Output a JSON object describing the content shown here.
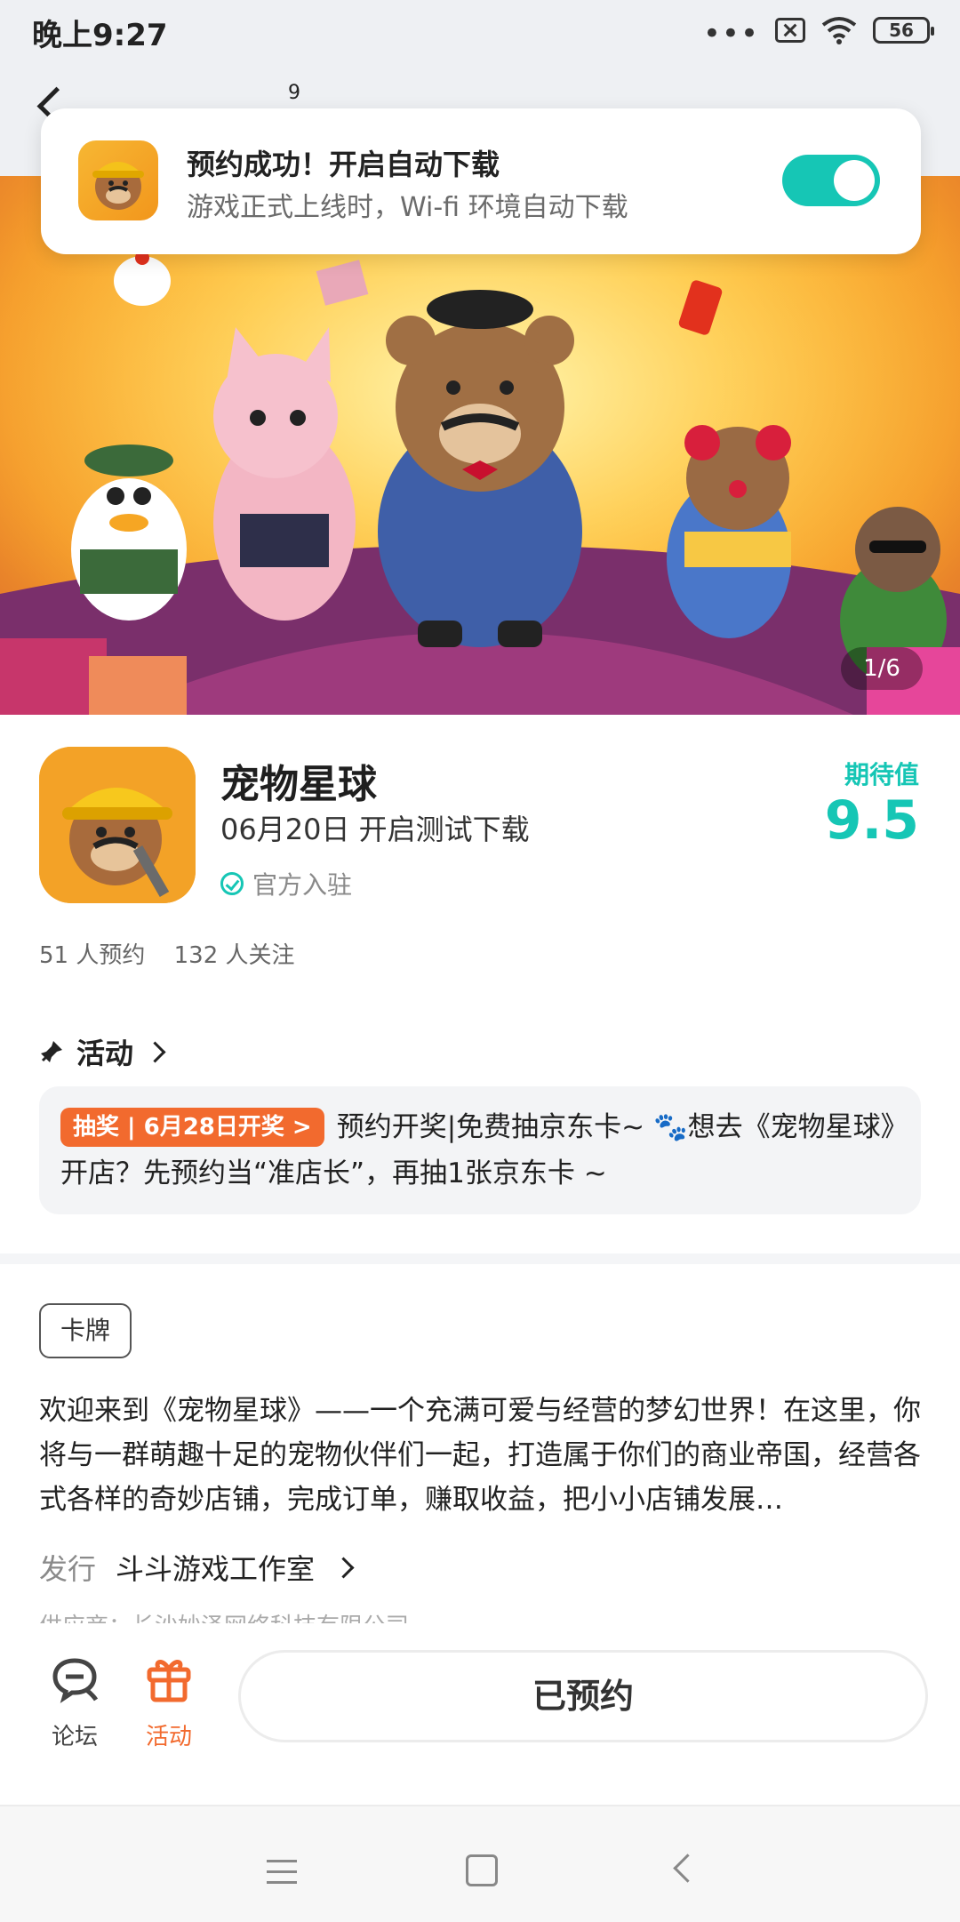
{
  "status_bar": {
    "time": "晚上9:27",
    "battery": "56",
    "icons": [
      "more-dots-icon",
      "sim-off-icon",
      "wifi-icon",
      "battery-icon"
    ]
  },
  "header": {
    "badge_count": "9"
  },
  "notification": {
    "title": "预约成功！开启自动下载",
    "subtitle": "游戏正式上线时，Wi-fi 环境自动下载",
    "toggle_on": true,
    "accent_color": "#16c6b5"
  },
  "banner": {
    "counter": "1/6"
  },
  "app": {
    "name": "宠物星球",
    "release": "06月20日 开启测试下载",
    "official": "官方入驻",
    "expect_label": "期待值",
    "expect_score": "9.5",
    "reservations": "51 人预约",
    "followers": "132 人关注"
  },
  "activity": {
    "heading": "活动",
    "tag": "抽奖 | 6月28日开奖 >",
    "text_part1": "预约开奖|免费抽京东卡~ ",
    "text_part2": "想去《宠物星球》开店？先预约当“准店长”，再抽1张京东卡 ~"
  },
  "details": {
    "genre_tag": "卡牌",
    "description": "欢迎来到《宠物星球》——一个充满可爱与经营的梦幻世界！在这里，你将与一群萌趣十足的宠物伙伴们一起，打造属于你们的商业帝国，经营各式各样的奇妙店铺，完成订单，赚取收益，把小小店铺发展…",
    "publisher_label": "发行",
    "publisher": "斗斗游戏工作室",
    "supplier": "供应商：长沙妙泽网络科技有限公司"
  },
  "action_bar": {
    "forum_label": "论坛",
    "activity_label": "活动",
    "reserve_button": "已预约",
    "activity_color": "#f26a2e"
  }
}
